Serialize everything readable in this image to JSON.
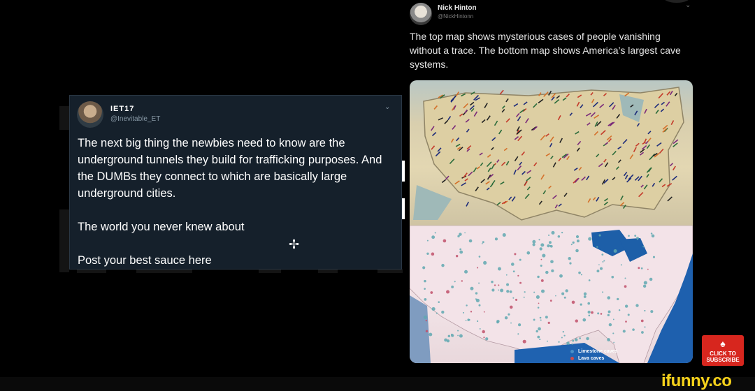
{
  "right_tweet": {
    "name": "Nick Hinton",
    "handle": "@NickHintonn",
    "text": "The top map shows mysterious cases of people vanishing without a trace. The bottom map shows America’s largest cave systems.",
    "legend": [
      {
        "label": "Limestone caves",
        "color": "#4a90c8"
      },
      {
        "label": "Lava caves",
        "color": "#d04a4a"
      }
    ]
  },
  "left_tweet": {
    "name": "IET17",
    "handle": "@Inevitable_ET",
    "paragraphs": [
      "The next big thing the newbies need to know are the underground tunnels they build for trafficking purposes. And the DUMBs they connect to which are basically large underground cities.",
      "The world you never knew about",
      "Post your best sauce here"
    ]
  },
  "watermark": "ifunny.co",
  "subscribe": {
    "line1": "CLICK TO",
    "line2": "SUBSCRIBE"
  }
}
